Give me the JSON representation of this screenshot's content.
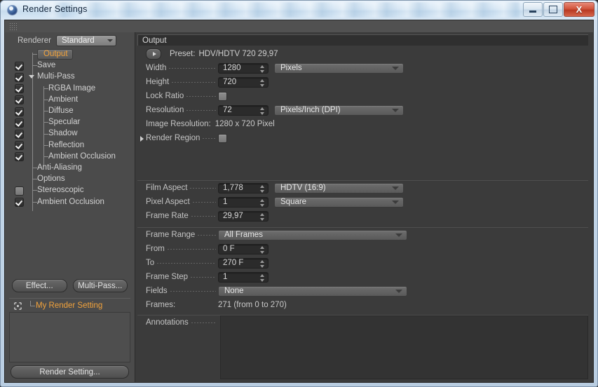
{
  "window": {
    "title": "Render Settings",
    "app_icon": "c4d-sphere-icon",
    "minimize_label": "Minimize",
    "maximize_label": "Maximize",
    "close_label": "X"
  },
  "sidebar": {
    "renderer_label": "Renderer",
    "renderer_value": "Standard",
    "tree": [
      {
        "label": "Output",
        "indent": 0,
        "check": "none",
        "selected": true,
        "disclosure": false
      },
      {
        "label": "Save",
        "indent": 0,
        "check": "on",
        "selected": false,
        "disclosure": false
      },
      {
        "label": "Multi-Pass",
        "indent": 0,
        "check": "on",
        "selected": false,
        "disclosure": true
      },
      {
        "label": "RGBA Image",
        "indent": 1,
        "check": "on",
        "selected": false,
        "disclosure": false
      },
      {
        "label": "Ambient",
        "indent": 1,
        "check": "on",
        "selected": false,
        "disclosure": false
      },
      {
        "label": "Diffuse",
        "indent": 1,
        "check": "on",
        "selected": false,
        "disclosure": false
      },
      {
        "label": "Specular",
        "indent": 1,
        "check": "on",
        "selected": false,
        "disclosure": false
      },
      {
        "label": "Shadow",
        "indent": 1,
        "check": "on",
        "selected": false,
        "disclosure": false
      },
      {
        "label": "Reflection",
        "indent": 1,
        "check": "on",
        "selected": false,
        "disclosure": false
      },
      {
        "label": "Ambient Occlusion",
        "indent": 1,
        "check": "on",
        "selected": false,
        "disclosure": false
      },
      {
        "label": "Anti-Aliasing",
        "indent": 0,
        "check": "none",
        "selected": false,
        "disclosure": false
      },
      {
        "label": "Options",
        "indent": 0,
        "check": "none",
        "selected": false,
        "disclosure": false
      },
      {
        "label": "Stereoscopic",
        "indent": 0,
        "check": "blank",
        "selected": false,
        "disclosure": false
      },
      {
        "label": "Ambient Occlusion",
        "indent": 0,
        "check": "on",
        "selected": false,
        "disclosure": false
      }
    ],
    "effect_button": "Effect...",
    "multipass_button": "Multi-Pass...",
    "my_render_setting": "My Render Setting",
    "render_setting_button": "Render Setting..."
  },
  "output_panel": {
    "header": "Output",
    "preset_label": "Preset:",
    "preset_value": "HDV/HDTV 720 29,97",
    "width_label": "Width",
    "width_value": "1280",
    "width_unit": "Pixels",
    "height_label": "Height",
    "height_value": "720",
    "lock_ratio_label": "Lock Ratio",
    "resolution_label": "Resolution",
    "resolution_value": "72",
    "resolution_unit": "Pixels/Inch (DPI)",
    "image_resolution_label": "Image Resolution:",
    "image_resolution_value": "1280 x 720 Pixel",
    "render_region_label": "Render Region",
    "film_aspect_label": "Film Aspect",
    "film_aspect_value": "1,778",
    "film_aspect_preset": "HDTV (16:9)",
    "pixel_aspect_label": "Pixel Aspect",
    "pixel_aspect_value": "1",
    "pixel_aspect_preset": "Square",
    "frame_rate_label": "Frame Rate",
    "frame_rate_value": "29,97",
    "frame_range_label": "Frame Range",
    "frame_range_value": "All Frames",
    "from_label": "From",
    "from_value": "0 F",
    "to_label": "To",
    "to_value": "270 F",
    "frame_step_label": "Frame Step",
    "frame_step_value": "1",
    "fields_label": "Fields",
    "fields_value": "None",
    "frames_label": "Frames:",
    "frames_value": "271 (from 0 to 270)",
    "annotations_label": "Annotations",
    "annotations_value": ""
  },
  "colors": {
    "accent": "#f2a33c",
    "panel_bg": "#3b3b3b",
    "sidebar_bg": "#4b4b4b",
    "titlebar": "#d6e6f4",
    "close_button": "#b93a23"
  }
}
